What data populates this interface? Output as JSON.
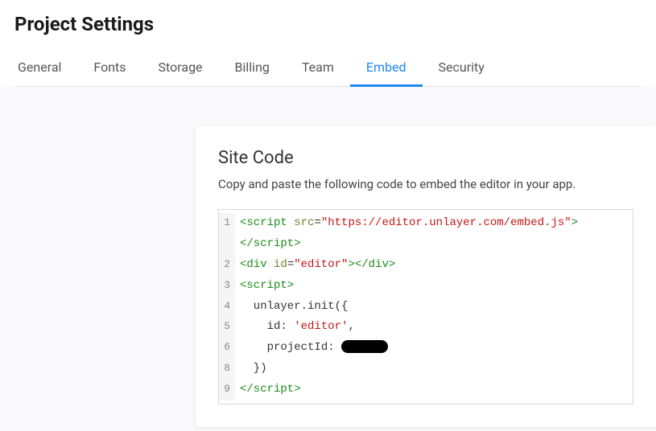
{
  "header": {
    "title": "Project Settings"
  },
  "tabs": [
    {
      "label": "General",
      "active": false
    },
    {
      "label": "Fonts",
      "active": false
    },
    {
      "label": "Storage",
      "active": false
    },
    {
      "label": "Billing",
      "active": false
    },
    {
      "label": "Team",
      "active": false
    },
    {
      "label": "Embed",
      "active": true
    },
    {
      "label": "Security",
      "active": false
    }
  ],
  "card": {
    "title": "Site Code",
    "description": "Copy and paste the following code to embed the editor in your app."
  },
  "code": {
    "lines": [
      {
        "n": "1",
        "parts": [
          {
            "t": "<script",
            "c": "tag"
          },
          {
            "t": " ",
            "c": "plain"
          },
          {
            "t": "src",
            "c": "attr"
          },
          {
            "t": "=",
            "c": "plain"
          },
          {
            "t": "\"https://editor.unlayer.com/embed.js\"",
            "c": "str"
          },
          {
            "t": ">",
            "c": "tag"
          }
        ]
      },
      {
        "n": "",
        "parts": [
          {
            "t": "</script>",
            "c": "tag"
          }
        ]
      },
      {
        "n": "2",
        "parts": [
          {
            "t": "<div",
            "c": "tag"
          },
          {
            "t": " ",
            "c": "plain"
          },
          {
            "t": "id",
            "c": "attr"
          },
          {
            "t": "=",
            "c": "plain"
          },
          {
            "t": "\"editor\"",
            "c": "str"
          },
          {
            "t": ">",
            "c": "tag"
          },
          {
            "t": "</div>",
            "c": "tag"
          }
        ]
      },
      {
        "n": "3",
        "parts": [
          {
            "t": "<script>",
            "c": "tag"
          }
        ]
      },
      {
        "n": "4",
        "parts": [
          {
            "t": "  unlayer.init({",
            "c": "plain"
          }
        ]
      },
      {
        "n": "5",
        "parts": [
          {
            "t": "    id: ",
            "c": "plain"
          },
          {
            "t": "'editor'",
            "c": "str"
          },
          {
            "t": ",",
            "c": "plain"
          }
        ]
      },
      {
        "n": "6",
        "parts": [
          {
            "t": "    projectId: ",
            "c": "plain"
          },
          {
            "t": "",
            "c": "redact"
          }
        ]
      },
      {
        "n": "8",
        "parts": [
          {
            "t": "  })",
            "c": "plain"
          }
        ]
      },
      {
        "n": "9",
        "parts": [
          {
            "t": "</script>",
            "c": "tag"
          }
        ]
      }
    ]
  }
}
